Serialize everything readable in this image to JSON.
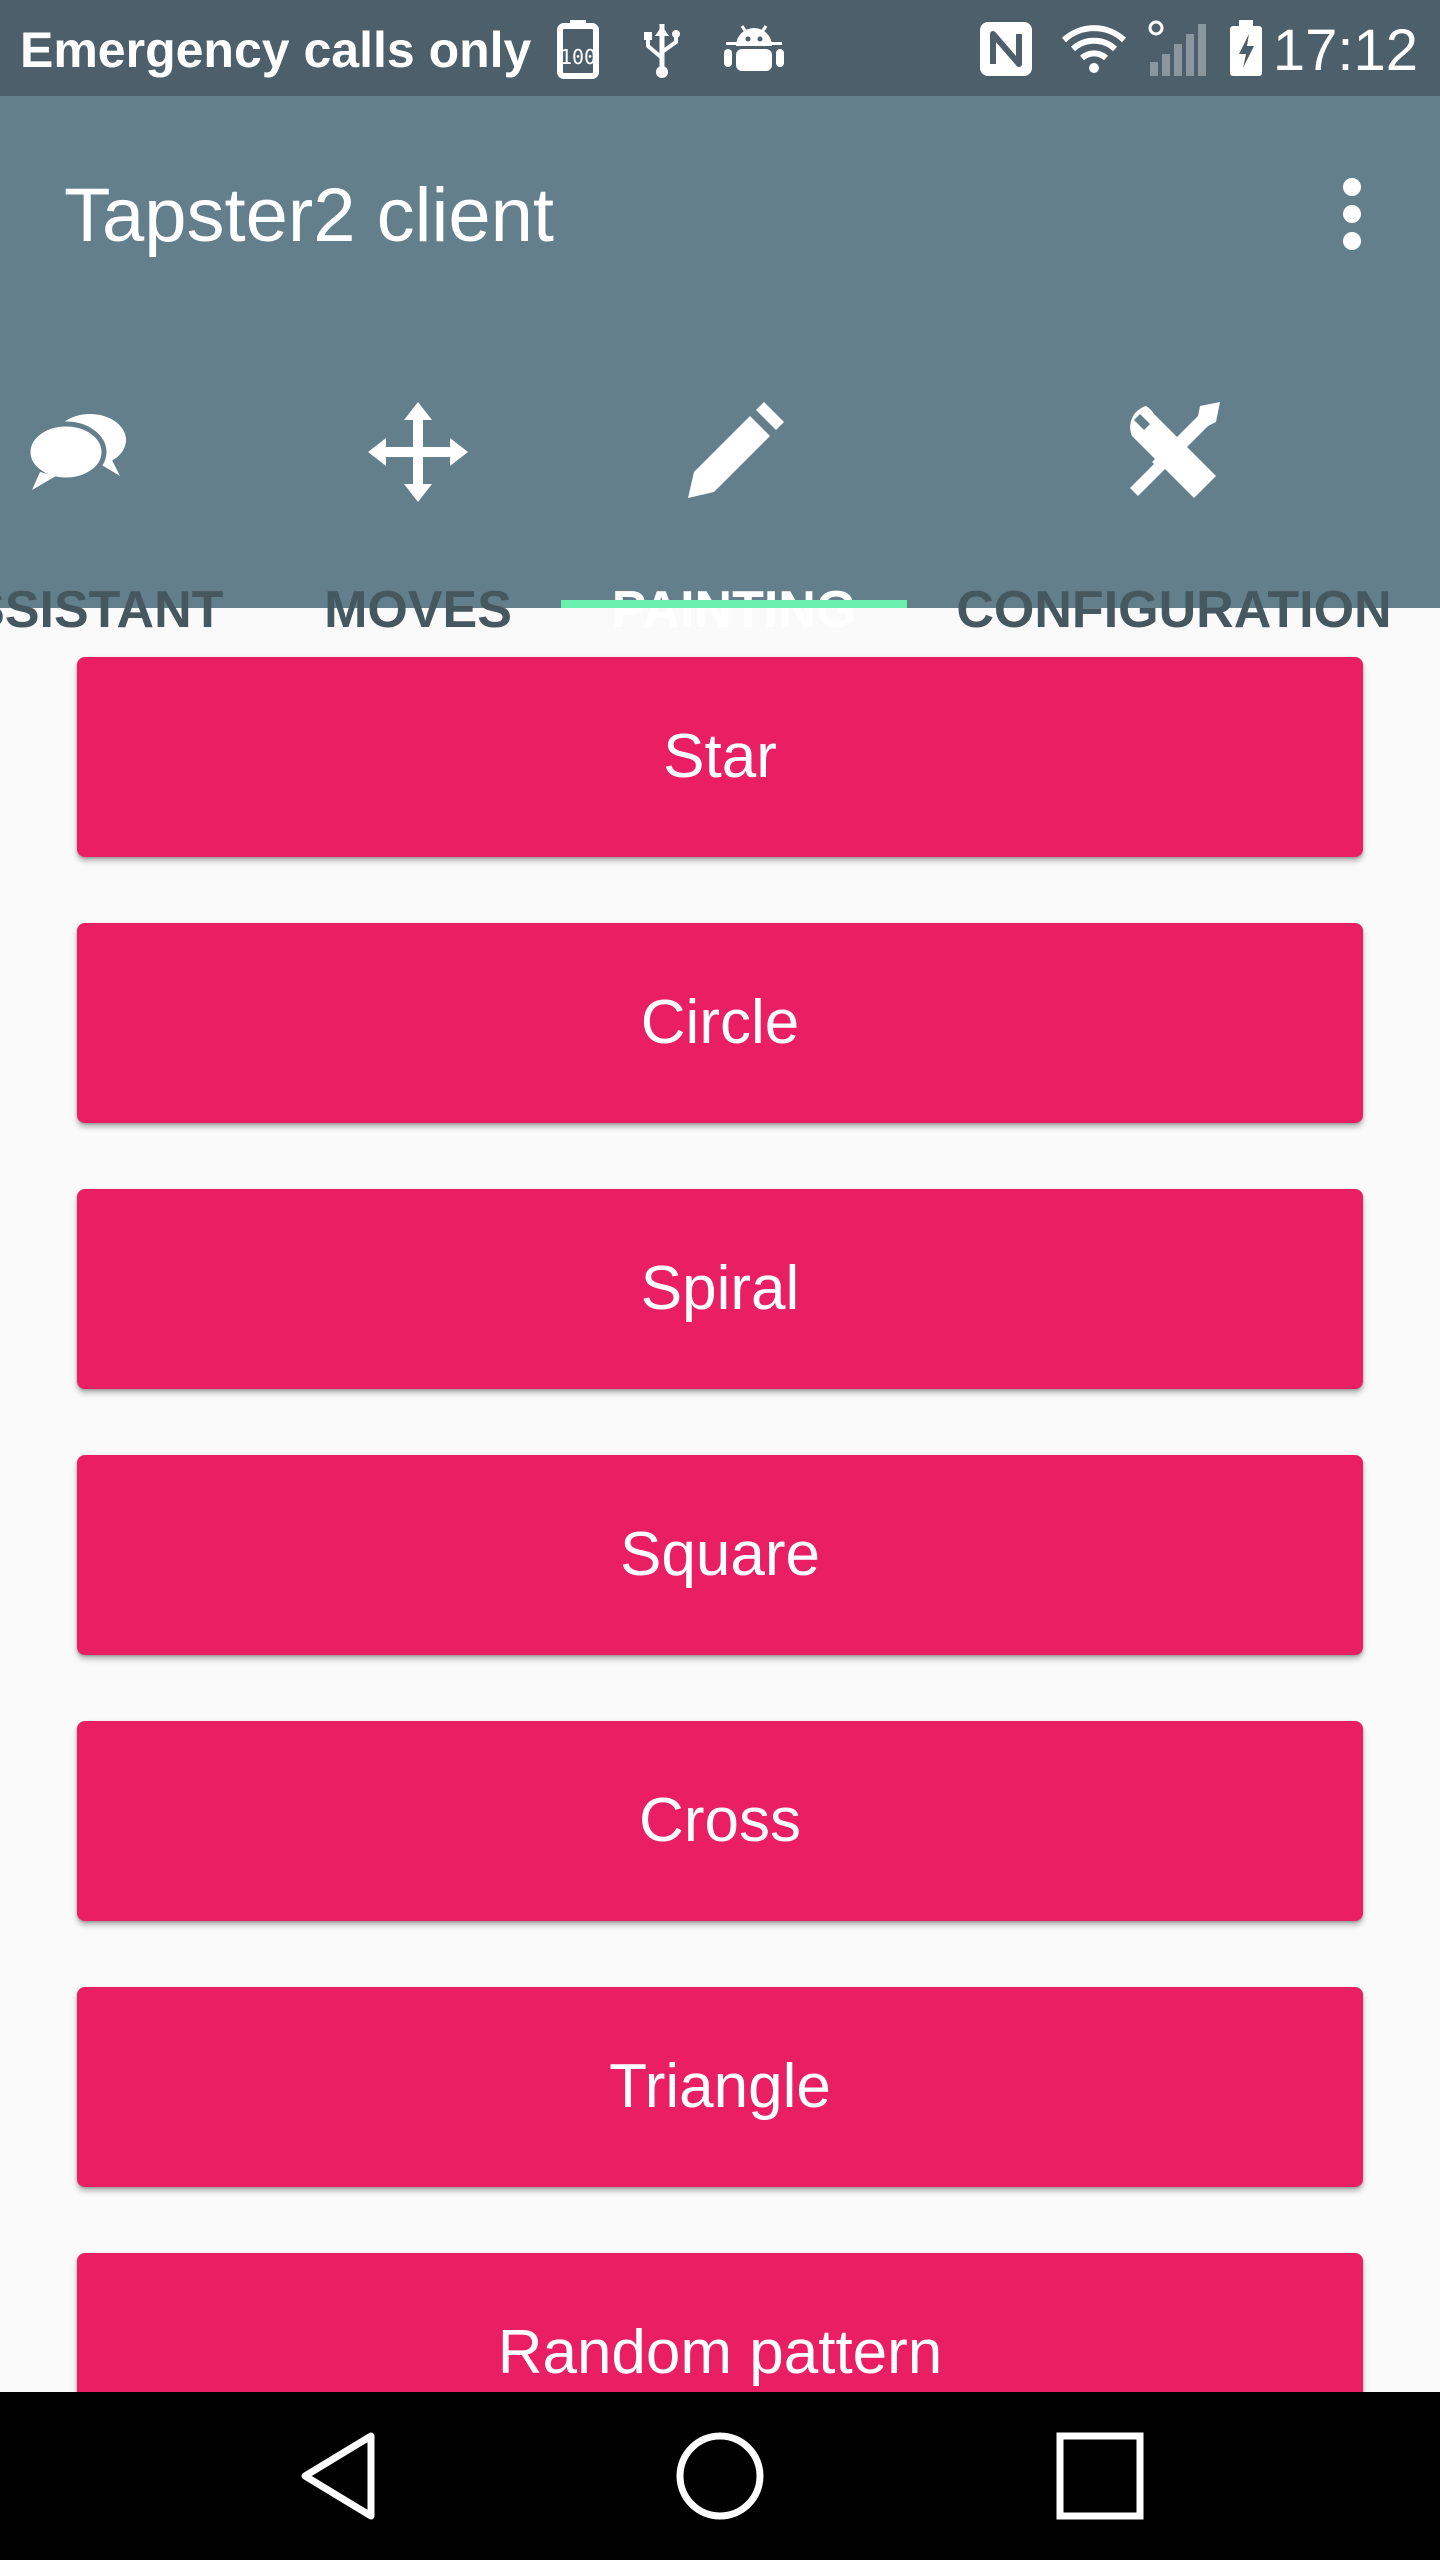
{
  "status_bar": {
    "carrier": "Emergency calls only",
    "battery_saver_badge": "100",
    "clock": "17:12",
    "icons": [
      "battery-percent-icon",
      "usb-icon",
      "android-debug-icon",
      "nfc-icon",
      "wifi-icon",
      "signal-icon",
      "battery-charging-icon"
    ]
  },
  "app_bar": {
    "title": "Tapster2 client",
    "overflow_icon": "more-vert-icon"
  },
  "tabs": [
    {
      "label": "ASSISTANT",
      "icon": "chat-bubbles-icon",
      "active": false
    },
    {
      "label": "MOVES",
      "icon": "move-arrows-icon",
      "active": false
    },
    {
      "label": "PAINTING",
      "icon": "pencil-icon",
      "active": true
    },
    {
      "label": "CONFIGURATION",
      "icon": "tools-icon",
      "active": false
    }
  ],
  "buttons": [
    {
      "label": "Star"
    },
    {
      "label": "Circle"
    },
    {
      "label": "Spiral"
    },
    {
      "label": "Square"
    },
    {
      "label": "Cross"
    },
    {
      "label": "Triangle"
    },
    {
      "label": "Random pattern"
    }
  ],
  "nav_bar": {
    "icons": [
      "back-icon",
      "home-icon",
      "recents-icon"
    ]
  },
  "colors": {
    "status_bar": "#4d5f6a",
    "app_bar": "#627f8b",
    "accent": "#e91e63",
    "tab_indicator": "#69f0ae",
    "inactive_tab": "#45575f",
    "background": "#fafafa"
  }
}
